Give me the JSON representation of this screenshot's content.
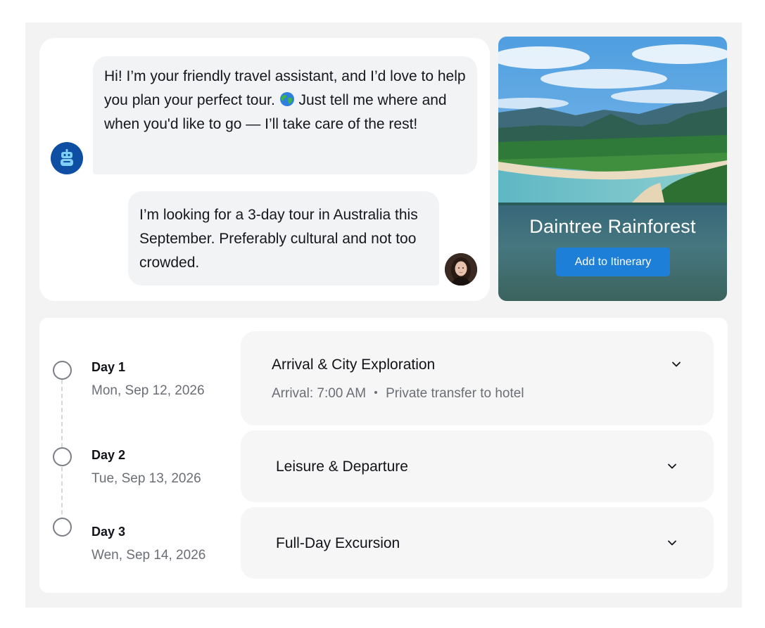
{
  "chat": {
    "bot_message_before_icon": "Hi! I’m your friendly travel assistant, and I’d love to help you plan your perfect tour.",
    "bot_message_after_icon": " Just tell me where and when you'd like to go — I’ll take care of the rest!",
    "bot_inline_icon": "globe-icon",
    "user_message": "I’m looking for a 3-day tour in Australia this September. Preferably cultural and not too crowded.",
    "bot_avatar_icon": "robot-icon",
    "user_avatar": "user-avatar-photo"
  },
  "destination": {
    "title": "Daintree Rainforest",
    "button_label": "Add to Itinerary",
    "button_color": "#1e7fd9"
  },
  "itinerary": {
    "days": [
      {
        "label": "Day 1",
        "date": "Mon, Sep 12, 2026",
        "title": "Arrival & City Exploration",
        "detail_arrival": "Arrival: 7:00 AM",
        "detail_transfer": "Private transfer to hotel",
        "expanded": true
      },
      {
        "label": "Day 2",
        "date": "Tue, Sep 13, 2026",
        "title": "Leisure & Departure",
        "expanded": false
      },
      {
        "label": "Day 3",
        "date": "Wen, Sep 14, 2026",
        "title": "Full-Day Excursion",
        "expanded": false
      }
    ]
  }
}
